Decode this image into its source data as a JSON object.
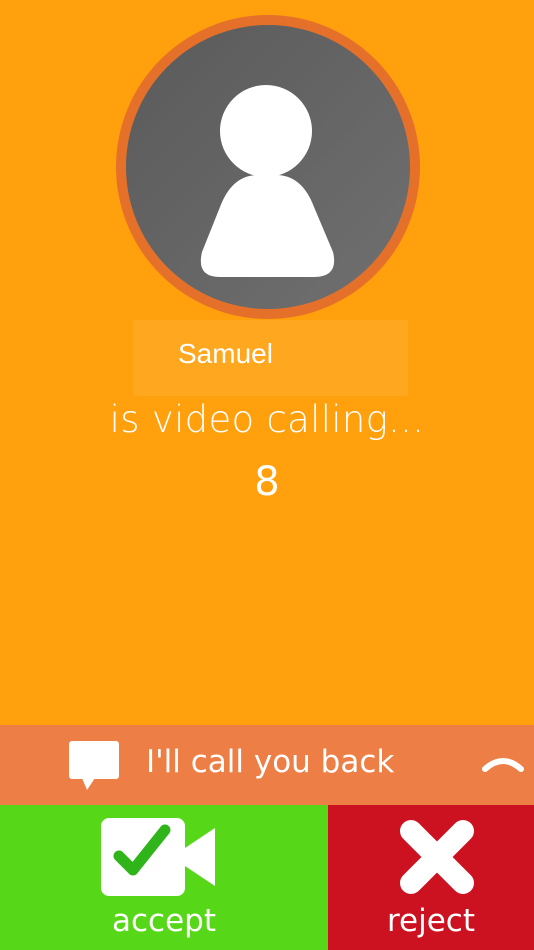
{
  "caller": {
    "name": "Samuel",
    "status": "is video calling...",
    "countdown": "8",
    "avatar_icon": "person-placeholder-icon"
  },
  "quick_reply": {
    "label": "I'll call you back",
    "icon": "chat-bubble-icon",
    "expand_icon": "chevron-up-icon"
  },
  "actions": {
    "accept": {
      "label": "accept",
      "icon": "video-check-icon",
      "color": "#56D818"
    },
    "reject": {
      "label": "reject",
      "icon": "x-icon",
      "color": "#CC1120"
    }
  },
  "colors": {
    "background": "#FFA00C",
    "avatar_ring": "#E5702A",
    "reply_bar": "#ED7E45"
  }
}
